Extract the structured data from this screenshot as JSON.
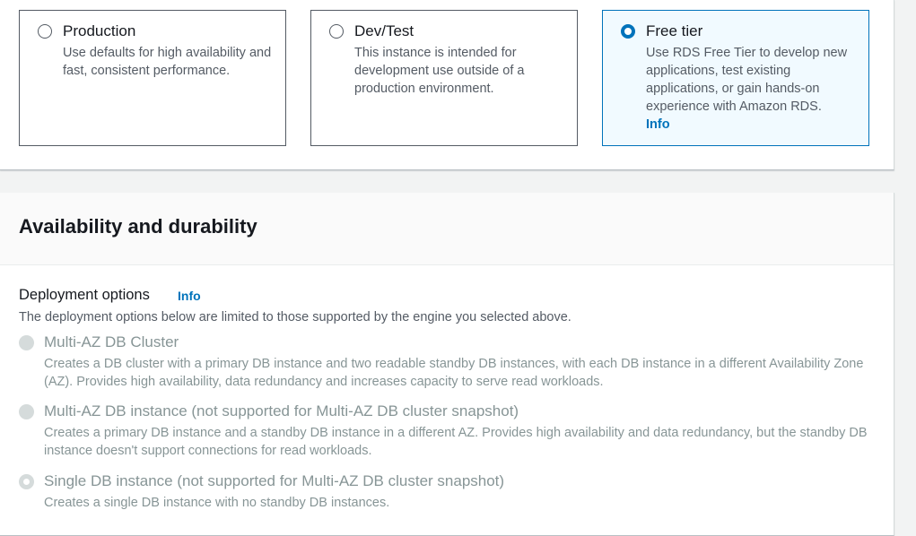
{
  "tiles": [
    {
      "title": "Production",
      "desc": "Use defaults for high availability and fast, consistent performance.",
      "selected": false
    },
    {
      "title": "Dev/Test",
      "desc": "This instance is intended for development use outside of a production environment.",
      "selected": false
    },
    {
      "title": "Free tier",
      "desc": "Use RDS Free Tier to develop new applications, test existing applications, or gain hands-on experience with Amazon RDS.",
      "info": "Info",
      "selected": true
    }
  ],
  "availability": {
    "heading": "Availability and durability",
    "deployment": {
      "label": "Deployment options",
      "info": "Info",
      "description": "The deployment options below are limited to those supported by the engine you selected above.",
      "options": [
        {
          "title": "Multi-AZ DB Cluster",
          "desc": "Creates a DB cluster with a primary DB instance and two readable standby DB instances, with each DB instance in a different Availability Zone (AZ). Provides high availability, data redundancy and increases capacity to serve read workloads.",
          "checked": false,
          "disabled": true
        },
        {
          "title": "Multi-AZ DB instance (not supported for Multi-AZ DB cluster snapshot)",
          "desc": "Creates a primary DB instance and a standby DB instance in a different AZ. Provides high availability and data redundancy, but the standby DB instance doesn't support connections for read workloads.",
          "checked": false,
          "disabled": true
        },
        {
          "title": "Single DB instance (not supported for Multi-AZ DB cluster snapshot)",
          "desc": "Creates a single DB instance with no standby DB instances.",
          "checked": true,
          "disabled": true
        }
      ]
    }
  },
  "colors": {
    "accent": "#0073bb",
    "selected_tile_bg": "#f1faff",
    "disabled_text": "#879596",
    "secondary_text": "#545b64"
  }
}
